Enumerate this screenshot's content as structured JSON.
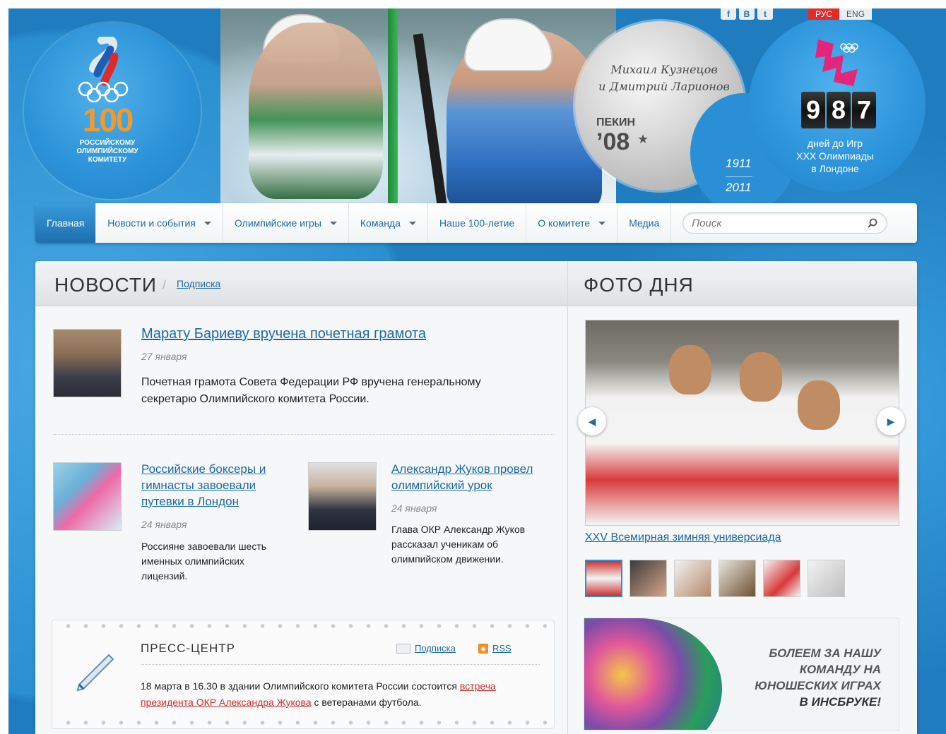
{
  "header": {
    "logo": {
      "number": "100",
      "lines": [
        "РОССИЙСКОМУ",
        "ОЛИМПИЙСКОМУ",
        "КОМИТЕТУ"
      ]
    },
    "medal": {
      "names_line1": "Михаил Кузнецов",
      "names_line2": "и Дмитрий Ларионов",
      "city": "ПЕКИН",
      "year": "’08"
    },
    "years": {
      "start": "1911",
      "end": "2011"
    },
    "social": [
      "f",
      "В",
      "t"
    ],
    "lang": {
      "ru": "РУС",
      "en": "ENG"
    },
    "countdown": {
      "digits": [
        "9",
        "8",
        "7"
      ],
      "text_line1": "дней до Игр",
      "text_line2": "XXX Олимпиады",
      "text_line3": "в Лондоне"
    }
  },
  "nav": {
    "items": [
      {
        "label": "Главная",
        "active": true
      },
      {
        "label": "Новости и события",
        "dropdown": true
      },
      {
        "label": "Олимпийские игры",
        "dropdown": true
      },
      {
        "label": "Команда",
        "dropdown": true
      },
      {
        "label": "Наше 100-летие"
      },
      {
        "label": "О комитете",
        "dropdown": true
      },
      {
        "label": "Медиа"
      }
    ],
    "search_placeholder": "Поиск"
  },
  "news": {
    "title": "НОВОСТИ",
    "subscribe": "Подписка",
    "items": [
      {
        "title": "Марату Бариеву вручена почетная грамота",
        "date": "27 января",
        "text": "Почетная грамота Совета Федерации РФ вручена генеральному секретарю Олимпийского комитета России."
      },
      {
        "title": "Российские боксеры и гимнасты завоевали путевки в Лондон",
        "date": "24 января",
        "text": "Россияне завоевали шесть именных олимпийских лицензий."
      },
      {
        "title": "Александр Жуков провел олимпийский урок",
        "date": "24 января",
        "text": "Глава ОКР Александр Жуков рассказал ученикам об олимпийском движении."
      }
    ]
  },
  "press": {
    "title": "ПРЕСС-ЦЕНТР",
    "subscribe": "Подписка",
    "rss": "RSS",
    "text_before": "18 марта в 16.30 в здании Олимпийского комитета России состоится ",
    "link": "встреча президента ОКР Александра Жукова",
    "text_after": " с ветеранами футбола."
  },
  "photo": {
    "title": "ФОТО ДНЯ",
    "caption": "XXV Всемирная зимняя универсиада",
    "thumb_count": 6
  },
  "banner": {
    "line1": "БОЛЕЕМ ЗА НАШУ",
    "line2": "КОМАНДУ НА",
    "line3": "ЮНОШЕСКИХ ИГРАХ",
    "line4": "В ИНСБРУКЕ!"
  },
  "colors": {
    "background_blue": "#2a8fd0",
    "link_blue": "#1a6aa8",
    "accent_red": "#d42b2b",
    "logo_orange": "#f39a2d"
  }
}
